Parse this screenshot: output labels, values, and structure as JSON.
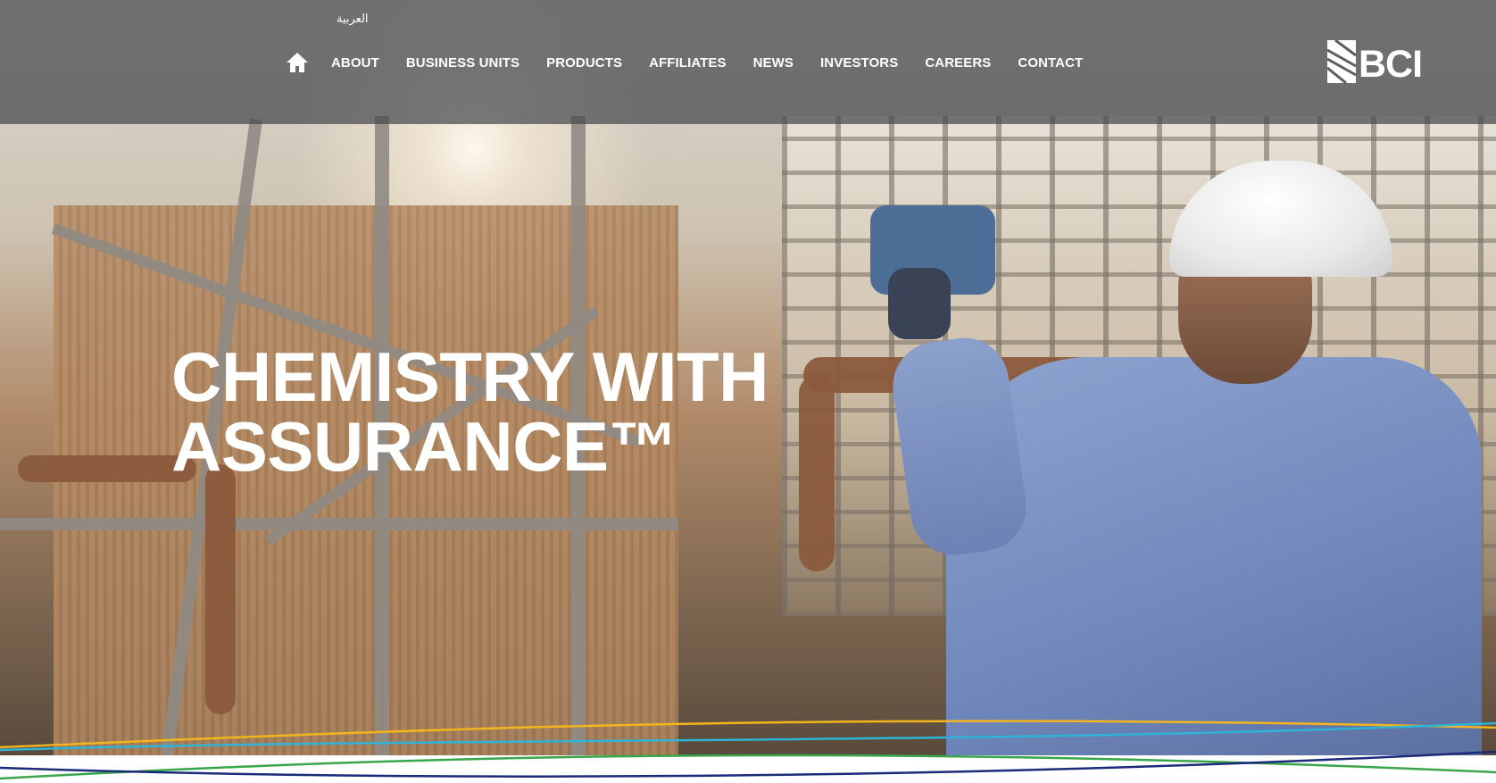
{
  "header": {
    "language_link": "العربية",
    "home_icon": "home-icon",
    "nav_items": [
      {
        "label": "ABOUT"
      },
      {
        "label": "BUSINESS UNITS"
      },
      {
        "label": "PRODUCTS"
      },
      {
        "label": "AFFILIATES"
      },
      {
        "label": "NEWS"
      },
      {
        "label": "INVESTORS"
      },
      {
        "label": "CAREERS"
      },
      {
        "label": "CONTACT"
      }
    ],
    "logo_text": "BCI"
  },
  "hero": {
    "headline_line1": "CHEMISTRY WITH",
    "headline_line2": "ASSURANCE™"
  },
  "colors": {
    "nav_overlay": "#46484e",
    "text": "#ffffff",
    "wave_yellow": "#f2b51e",
    "wave_cyan": "#2fb3d6",
    "wave_green": "#3aa64a",
    "wave_navy": "#1b2a7a"
  }
}
